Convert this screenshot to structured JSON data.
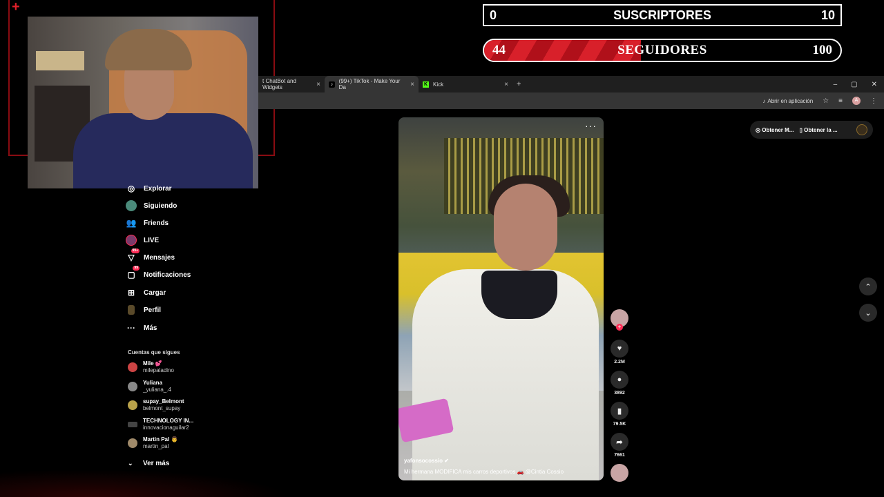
{
  "overlay": {
    "subscribers": {
      "current": "0",
      "title": "SUSCRIPTORES",
      "goal": "10"
    },
    "followers": {
      "current": "44",
      "title": "SEGUIDORES",
      "goal": "100",
      "progress": 0.44
    },
    "cam_plus": "+"
  },
  "browser": {
    "tabs": [
      {
        "label": "t ChatBot and Widgets",
        "close": "×"
      },
      {
        "label": "(99+) TikTok - Make Your Da",
        "icon": "♪",
        "close": "×"
      },
      {
        "label": "Kick",
        "icon": "K",
        "close": "×"
      }
    ],
    "new_tab": "+",
    "window_controls": [
      "–",
      "▢",
      "✕"
    ],
    "open_in_app": "Abrir en aplicación",
    "profile_initial": "A"
  },
  "sidebar": {
    "items": [
      {
        "label": "Explorar",
        "icon": "compass"
      },
      {
        "label": "Siguiendo",
        "icon": "avatar"
      },
      {
        "label": "Friends",
        "icon": "people"
      },
      {
        "label": "LIVE",
        "icon": "live"
      },
      {
        "label": "Mensajes",
        "icon": "message",
        "badge": "99+"
      },
      {
        "label": "Notificaciones",
        "icon": "inbox",
        "badge": "99"
      },
      {
        "label": "Cargar",
        "icon": "upload"
      },
      {
        "label": "Perfil",
        "icon": "profile"
      },
      {
        "label": "Más",
        "icon": "more"
      }
    ],
    "following_title": "Cuentas que sigues",
    "accounts": [
      {
        "name": "Mile 💕",
        "user": "milepaladino"
      },
      {
        "name": "Yuliana",
        "user": "_yuliana_.4"
      },
      {
        "name": "supay_Belmont",
        "user": "belmont_supay"
      },
      {
        "name": "TECHNOLOGY IN...",
        "user": "innovacionaguilar2"
      },
      {
        "name": "Martin Pal 👨",
        "user": "martin_pal"
      }
    ],
    "see_more": "Ver más"
  },
  "video": {
    "author": "yafonsocossio ✔",
    "description": "Mi hermana MODIFICA mis carros deportivos 🚗 @Cintia Cossio",
    "more": "···"
  },
  "actions": {
    "likes": "2.2M",
    "comments": "3892",
    "saves": "79.5K",
    "shares": "7661"
  },
  "right_panel": {
    "coins_label": "Obtener M...",
    "app_label": "Obtener la ...",
    "scroll_up": "⌃",
    "scroll_down": "⌄"
  }
}
